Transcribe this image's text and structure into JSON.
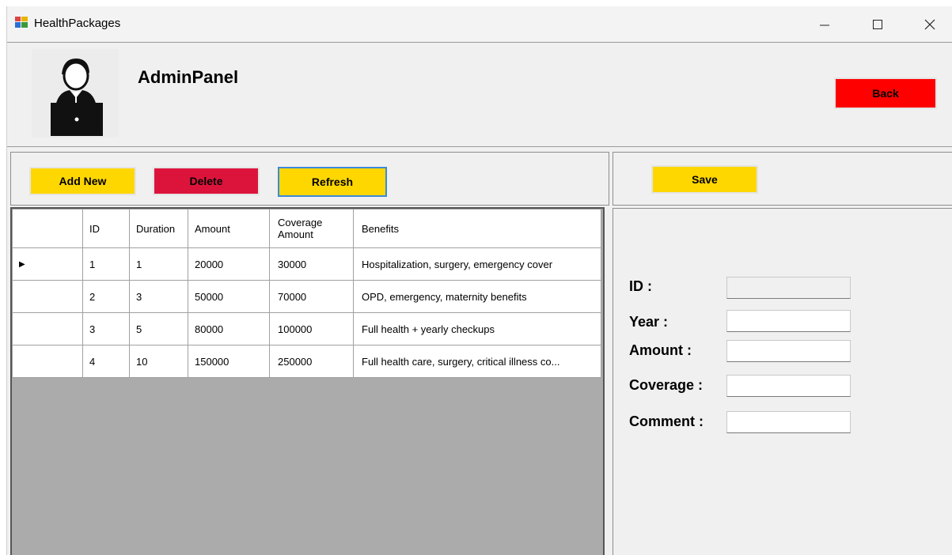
{
  "window": {
    "title": "HealthPackages",
    "min_icon": "minimize-icon",
    "max_icon": "maximize-icon",
    "close_icon": "close-icon"
  },
  "header": {
    "avatar_icon": "admin-user-icon",
    "title": "AdminPanel",
    "back_label": "Back"
  },
  "toolbar": {
    "add_label": "Add New",
    "delete_label": "Delete",
    "refresh_label": "Refresh",
    "save_label": "Save"
  },
  "grid": {
    "columns": [
      "ID",
      "Duration",
      "Amount",
      "Coverage Amount",
      "Benefits"
    ],
    "rows": [
      [
        "1",
        "1",
        "20000",
        "30000",
        "Hospitalization, surgery, emergency cover"
      ],
      [
        "2",
        "3",
        "50000",
        "70000",
        "OPD, emergency, maternity benefits"
      ],
      [
        "3",
        "5",
        "80000",
        "100000",
        "Full health + yearly checkups"
      ],
      [
        "4",
        "10",
        "150000",
        "250000",
        "Full health care, surgery, critical illness co..."
      ]
    ],
    "current_row_marker": "▶"
  },
  "form": {
    "id_label": "ID :",
    "year_label": "Year :",
    "amount_label": "Amount :",
    "coverage_label": "Coverage :",
    "comment_label": "Comment :",
    "id_value": "",
    "year_value": "",
    "amount_value": "",
    "coverage_value": "",
    "comment_value": ""
  },
  "colors": {
    "yellow": "#ffd700",
    "delete_red": "#dc143c",
    "back_red": "#ff0000"
  }
}
